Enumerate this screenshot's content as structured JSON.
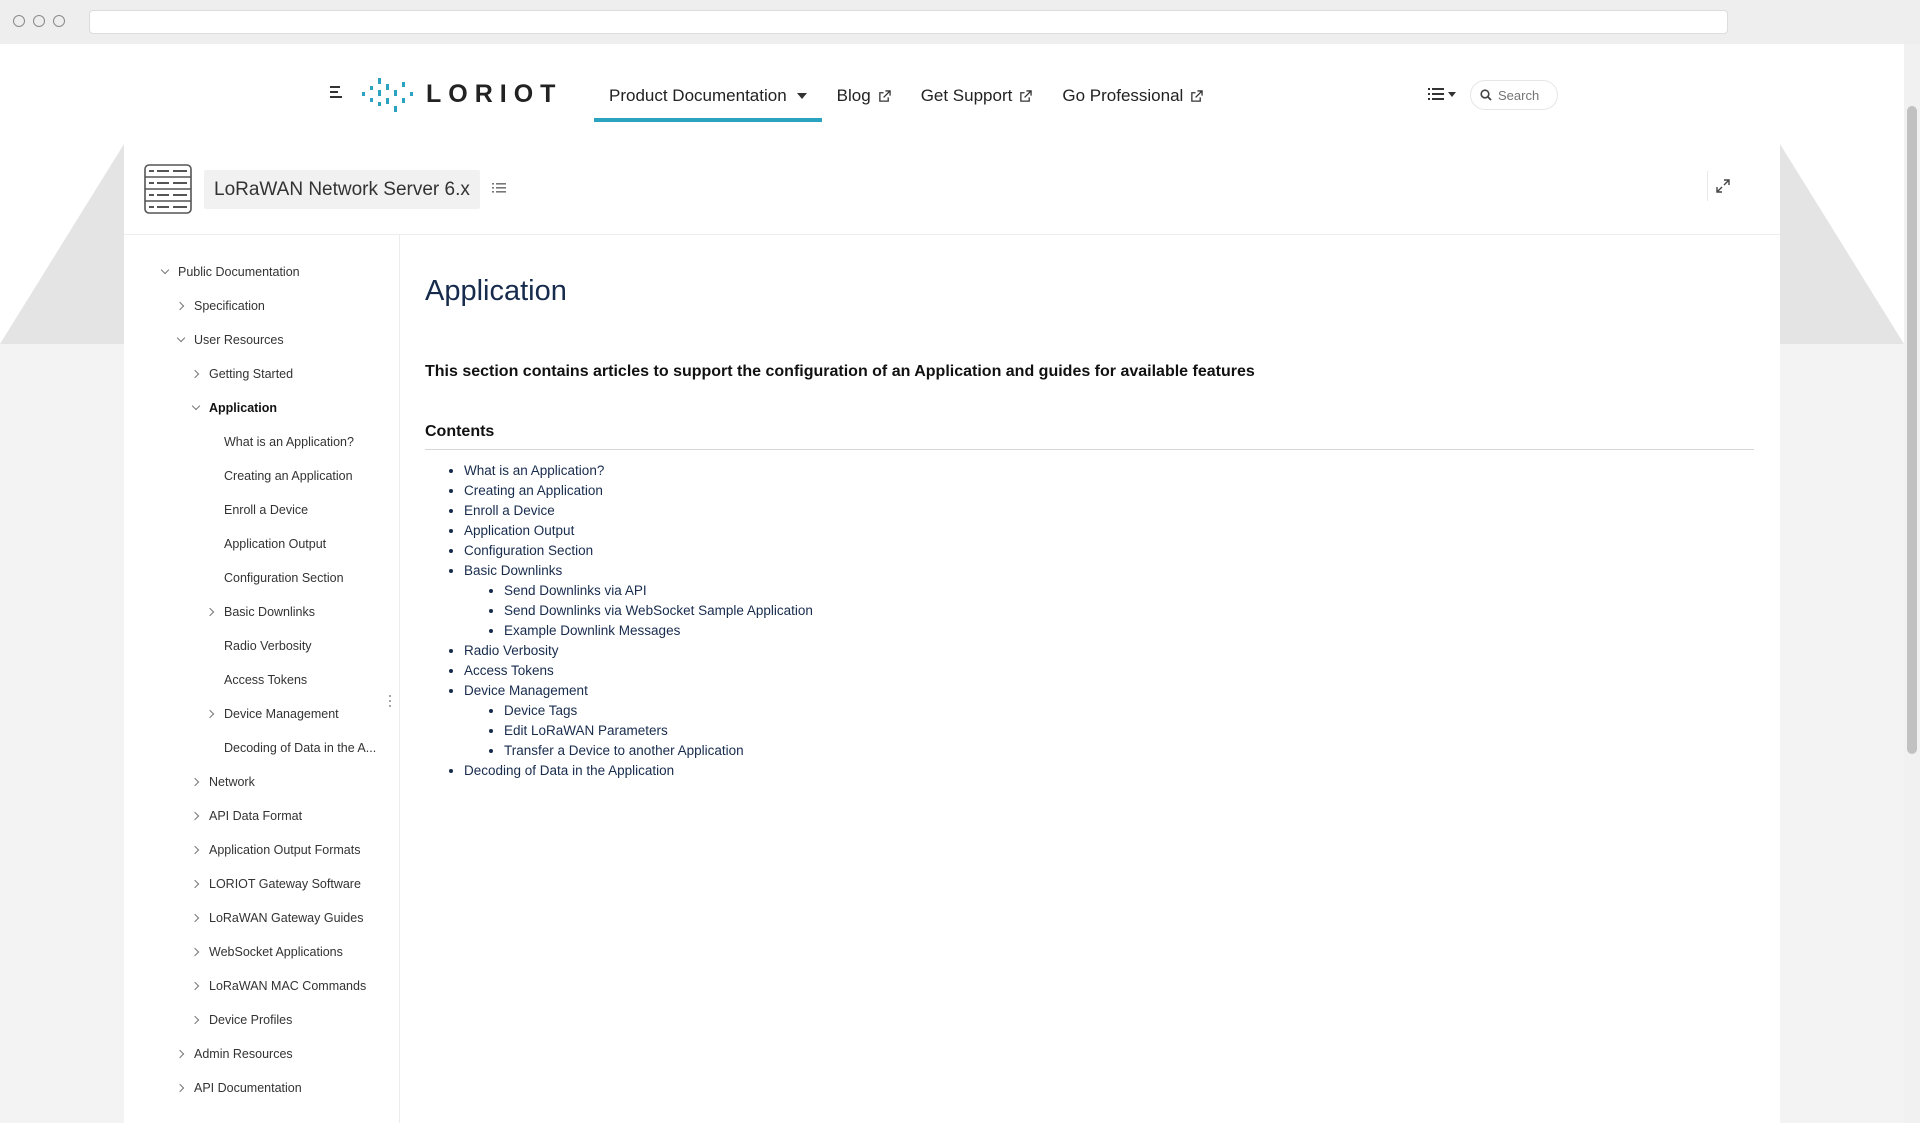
{
  "nav": {
    "logo_text": "LORIOT",
    "items": [
      {
        "label": "Product Documentation",
        "active": true,
        "type": "dropdown"
      },
      {
        "label": "Blog",
        "external": true
      },
      {
        "label": "Get Support",
        "external": true
      },
      {
        "label": "Go Professional",
        "external": true
      }
    ],
    "search_placeholder": "Search"
  },
  "space": {
    "title": "LoRaWAN Network Server 6.x"
  },
  "sidebar": {
    "items": [
      {
        "label": "Public Documentation",
        "expanded": true,
        "level": 0
      },
      {
        "label": "Specification",
        "expanded": false,
        "level": 1
      },
      {
        "label": "User Resources",
        "expanded": true,
        "level": 1
      },
      {
        "label": "Getting Started",
        "expanded": false,
        "level": 2
      },
      {
        "label": "Application",
        "expanded": true,
        "level": 2,
        "current": true
      },
      {
        "label": "What is an Application?",
        "level": 3
      },
      {
        "label": "Creating an Application",
        "level": 3
      },
      {
        "label": "Enroll a Device",
        "level": 3
      },
      {
        "label": "Application Output",
        "level": 3
      },
      {
        "label": "Configuration Section",
        "level": 3
      },
      {
        "label": "Basic Downlinks",
        "expanded": false,
        "level": 3
      },
      {
        "label": "Radio Verbosity",
        "level": 3
      },
      {
        "label": "Access Tokens",
        "level": 3
      },
      {
        "label": "Device Management",
        "expanded": false,
        "level": 3
      },
      {
        "label": "Decoding of Data in the A...",
        "level": 3
      },
      {
        "label": "Network",
        "expanded": false,
        "level": 2
      },
      {
        "label": "API Data Format",
        "expanded": false,
        "level": 2
      },
      {
        "label": "Application Output Formats",
        "expanded": false,
        "level": 2
      },
      {
        "label": "LORIOT Gateway Software",
        "expanded": false,
        "level": 2
      },
      {
        "label": "LoRaWAN Gateway Guides",
        "expanded": false,
        "level": 2
      },
      {
        "label": "WebSocket Applications",
        "expanded": false,
        "level": 2
      },
      {
        "label": "LoRaWAN MAC Commands",
        "expanded": false,
        "level": 2
      },
      {
        "label": "Device Profiles",
        "expanded": false,
        "level": 2
      },
      {
        "label": "Admin Resources",
        "expanded": false,
        "level": 1
      },
      {
        "label": "API Documentation",
        "expanded": false,
        "level": 1
      }
    ]
  },
  "page": {
    "title": "Application",
    "intro": "This section contains articles to support the configuration of an Application and guides for available features",
    "contents_heading": "Contents",
    "toc": [
      {
        "label": "What is an Application?"
      },
      {
        "label": "Creating an Application"
      },
      {
        "label": "Enroll a Device"
      },
      {
        "label": "Application Output"
      },
      {
        "label": "Configuration Section"
      },
      {
        "label": "Basic Downlinks",
        "children": [
          {
            "label": "Send Downlinks via API"
          },
          {
            "label": "Send Downlinks via WebSocket Sample Application"
          },
          {
            "label": "Example Downlink Messages"
          }
        ]
      },
      {
        "label": "Radio Verbosity"
      },
      {
        "label": "Access Tokens"
      },
      {
        "label": "Device Management",
        "children": [
          {
            "label": "Device Tags"
          },
          {
            "label": "Edit LoRaWAN Parameters"
          },
          {
            "label": "Transfer a Device to another Application"
          }
        ]
      },
      {
        "label": "Decoding of Data in the Application"
      }
    ]
  },
  "colors": {
    "accent": "#2aa3c0",
    "text": "#172b4d"
  }
}
